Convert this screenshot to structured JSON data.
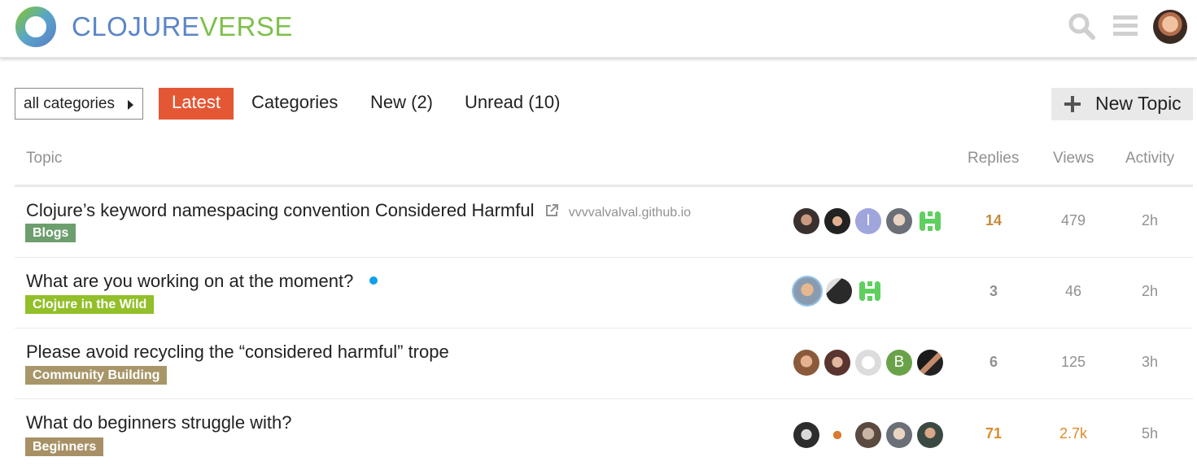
{
  "header": {
    "logo_text_part1": "CLOJURE",
    "logo_text_part2": "VERSE",
    "icons": [
      "logo-ring-icon",
      "search-icon",
      "hamburger-menu-icon",
      "user-avatar"
    ]
  },
  "nav": {
    "category_dropdown": "all categories",
    "tabs": [
      {
        "label": "Latest",
        "active": true
      },
      {
        "label": "Categories"
      },
      {
        "label": "New (2)"
      },
      {
        "label": "Unread (10)"
      }
    ],
    "new_topic": "New Topic"
  },
  "table": {
    "headers": {
      "topic": "Topic",
      "replies": "Replies",
      "views": "Views",
      "activity": "Activity"
    },
    "rows": [
      {
        "title": "Clojure’s keyword namespacing convention Considered Harmful",
        "link_domain": "vvvvalvalval.github.io",
        "category": "Blogs",
        "category_color": "#6d9e6d",
        "replies": "14",
        "views": "479",
        "activity": "2h"
      },
      {
        "title": "What are you working on at the moment?",
        "category": "Clojure in the Wild",
        "category_color": "#92bf2a",
        "replies": "3",
        "views": "46",
        "activity": "2h"
      },
      {
        "title": "Please avoid recycling the “considered harmful” trope",
        "category": "Community Building",
        "category_color": "#a8966a",
        "replies": "6",
        "views": "125",
        "activity": "3h"
      },
      {
        "title": "What do beginners struggle with?",
        "category": "Beginners",
        "category_color": "#a89066",
        "replies": "71",
        "views": "2.7k",
        "activity": "5h"
      }
    ]
  },
  "colors": {
    "accent": "#e45735",
    "unread_dot": "#0fa0ea",
    "hot_count": "#c58a3a",
    "muted": "#919191"
  }
}
